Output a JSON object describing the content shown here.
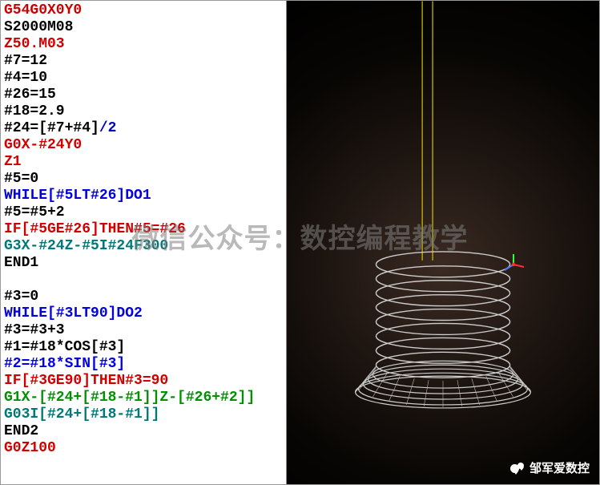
{
  "code": {
    "lines": [
      {
        "segments": [
          {
            "text": "G54G0X0Y0",
            "color": "c-red"
          }
        ]
      },
      {
        "segments": [
          {
            "text": "S2000M08",
            "color": "c-black"
          }
        ]
      },
      {
        "segments": [
          {
            "text": "Z50.M03",
            "color": "c-red"
          }
        ]
      },
      {
        "segments": [
          {
            "text": "#7=12",
            "color": "c-black"
          }
        ]
      },
      {
        "segments": [
          {
            "text": "#4=10",
            "color": "c-black"
          }
        ]
      },
      {
        "segments": [
          {
            "text": "#26=15",
            "color": "c-black"
          }
        ]
      },
      {
        "segments": [
          {
            "text": "#18=2.9",
            "color": "c-black"
          }
        ]
      },
      {
        "segments": [
          {
            "text": "#24=[#7+#4]",
            "color": "c-black"
          },
          {
            "text": "/2",
            "color": "c-dblue"
          }
        ]
      },
      {
        "segments": [
          {
            "text": "G0X-#24Y0",
            "color": "c-red"
          }
        ]
      },
      {
        "segments": [
          {
            "text": "Z1",
            "color": "c-red"
          }
        ]
      },
      {
        "segments": [
          {
            "text": "#5=0",
            "color": "c-black"
          }
        ]
      },
      {
        "segments": [
          {
            "text": "WHILE[#5LT#26]DO1",
            "color": "c-blue"
          }
        ]
      },
      {
        "segments": [
          {
            "text": "#5=#5+2",
            "color": "c-black"
          }
        ]
      },
      {
        "segments": [
          {
            "text": "IF[#5GE#26]THEN#5=#26",
            "color": "c-red"
          }
        ]
      },
      {
        "segments": [
          {
            "text": "G3X-#24Z-#5I#24F300",
            "color": "c-cyan"
          }
        ]
      },
      {
        "segments": [
          {
            "text": "END1",
            "color": "c-black"
          }
        ]
      },
      {
        "segments": [
          {
            "text": " ",
            "color": "c-black"
          }
        ]
      },
      {
        "segments": [
          {
            "text": "#3=0",
            "color": "c-black"
          }
        ]
      },
      {
        "segments": [
          {
            "text": "WHILE[#3LT90]DO2",
            "color": "c-blue"
          }
        ]
      },
      {
        "segments": [
          {
            "text": "#3=#3+3",
            "color": "c-black"
          }
        ]
      },
      {
        "segments": [
          {
            "text": "#1=#18*COS[#3]",
            "color": "c-black"
          }
        ]
      },
      {
        "segments": [
          {
            "text": "#2=#18*SIN[#3]",
            "color": "c-blue"
          }
        ]
      },
      {
        "segments": [
          {
            "text": "IF[#3GE90]THEN#3=90",
            "color": "c-red"
          }
        ]
      },
      {
        "segments": [
          {
            "text": "G1X-[#24+[#18-#1]]Z-[#26+#2]]",
            "color": "c-green"
          }
        ]
      },
      {
        "segments": [
          {
            "text": "G03I[#24+[#18-#1]]",
            "color": "c-cyan"
          }
        ]
      },
      {
        "segments": [
          {
            "text": "END2",
            "color": "c-black"
          }
        ]
      },
      {
        "segments": [
          {
            "text": "G0Z100",
            "color": "c-red"
          }
        ]
      }
    ]
  },
  "watermark": "微信公众号：数控编程教学",
  "credit": {
    "icon_name": "wechat-icon",
    "text": "邹军爱数控"
  },
  "viewport": {
    "rapid_color": "#d4c400",
    "path_color": "#cccccc",
    "axis": {
      "x_color": "#ff3030",
      "y_color": "#30ff30",
      "z_color": "#5070ff",
      "origin_color": "#ff3030"
    }
  }
}
